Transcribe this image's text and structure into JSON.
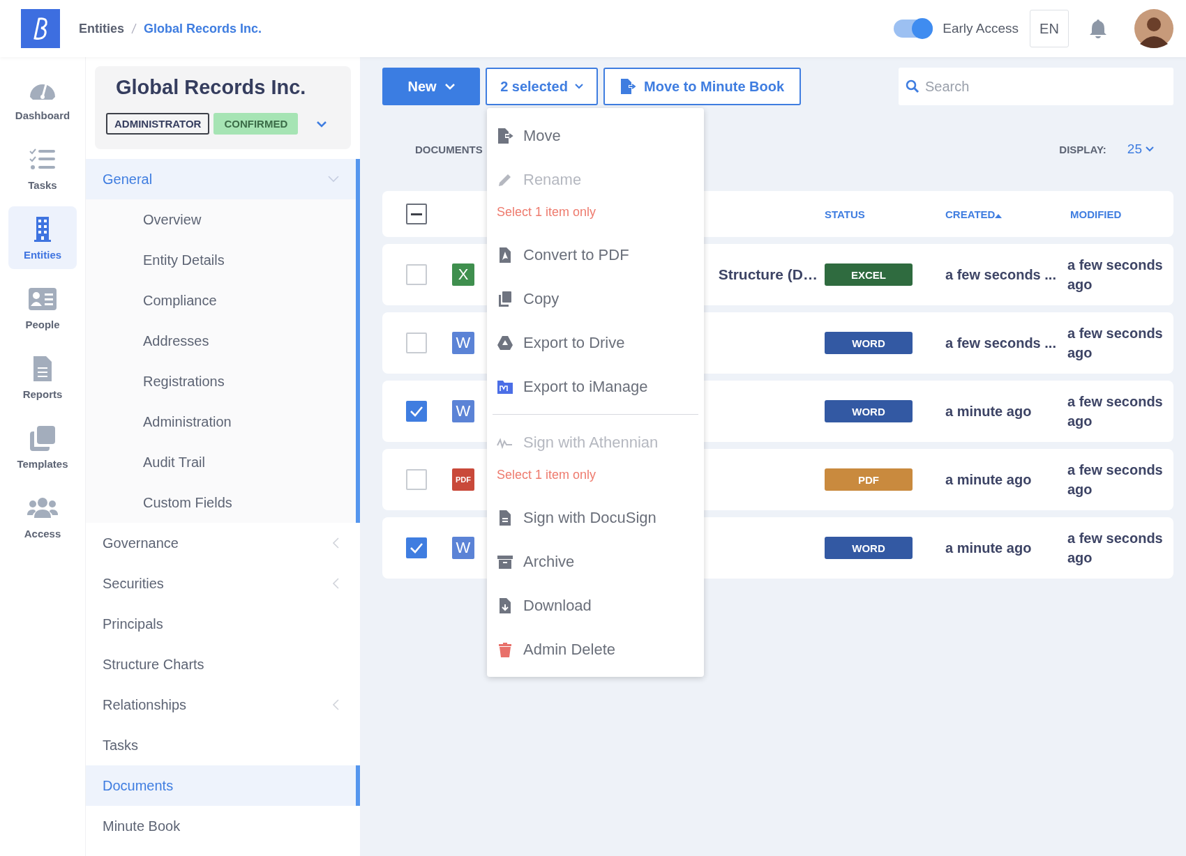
{
  "topbar": {
    "breadcrumbs": [
      {
        "label": "Entities",
        "current": false
      },
      {
        "label": "Global Records Inc.",
        "current": true
      }
    ],
    "early_access": {
      "label": "Early Access",
      "on": true
    },
    "language": "EN"
  },
  "rail": [
    {
      "label": "Dashboard",
      "selected": false
    },
    {
      "label": "Tasks",
      "selected": false
    },
    {
      "label": "Entities",
      "selected": true
    },
    {
      "label": "People",
      "selected": false
    },
    {
      "label": "Reports",
      "selected": false
    },
    {
      "label": "Templates",
      "selected": false
    },
    {
      "label": "Access",
      "selected": false
    }
  ],
  "entity": {
    "name": "Global Records Inc.",
    "role": "ADMINISTRATOR",
    "status": "CONFIRMED"
  },
  "nav": [
    {
      "label": "General",
      "expanded": true,
      "selected": false,
      "children": [
        {
          "label": "Overview"
        },
        {
          "label": "Entity Details"
        },
        {
          "label": "Compliance"
        },
        {
          "label": "Addresses"
        },
        {
          "label": "Registrations"
        },
        {
          "label": "Administration"
        },
        {
          "label": "Audit Trail"
        },
        {
          "label": "Custom Fields"
        }
      ]
    },
    {
      "label": "Governance",
      "expanded": false,
      "selected": false
    },
    {
      "label": "Securities",
      "expanded": false,
      "selected": false
    },
    {
      "label": "Principals",
      "selected": false
    },
    {
      "label": "Structure Charts",
      "selected": false
    },
    {
      "label": "Relationships",
      "expanded": false,
      "selected": false
    },
    {
      "label": "Tasks",
      "selected": false
    },
    {
      "label": "Documents",
      "selected": true
    },
    {
      "label": "Minute Book",
      "selected": false
    }
  ],
  "toolbar": {
    "new_label": "New",
    "selection_label": "2 selected",
    "move_label": "Move to Minute Book",
    "search": {
      "placeholder": "Search"
    }
  },
  "documents_label": "DOCUMENTS",
  "display": {
    "label": "DISPLAY:",
    "value": "25"
  },
  "menu": [
    {
      "kind": "action",
      "label": "Move",
      "disabled": false
    },
    {
      "kind": "action",
      "label": "Rename",
      "disabled": true
    },
    {
      "kind": "hint",
      "label": "Select 1 item only"
    },
    {
      "kind": "action",
      "label": "Convert to PDF",
      "disabled": false
    },
    {
      "kind": "action",
      "label": "Copy",
      "disabled": false
    },
    {
      "kind": "action",
      "label": "Export to Drive",
      "disabled": false
    },
    {
      "kind": "action",
      "label": "Export to iManage",
      "disabled": false
    },
    {
      "kind": "divider"
    },
    {
      "kind": "action",
      "label": "Sign with Athennian",
      "disabled": true
    },
    {
      "kind": "hint",
      "label": "Select 1 item only"
    },
    {
      "kind": "action",
      "label": "Sign with DocuSign",
      "disabled": false
    },
    {
      "kind": "action",
      "label": "Archive",
      "disabled": false
    },
    {
      "kind": "action",
      "label": "Download",
      "disabled": false
    },
    {
      "kind": "action",
      "label": "Admin Delete",
      "disabled": false
    }
  ],
  "table": {
    "select_all_indeterminate": true,
    "columns": [
      {
        "label": "STATUS",
        "sorted": false
      },
      {
        "label": "CREATED",
        "sorted": true
      },
      {
        "label": "MODIFIED",
        "sorted": false
      }
    ],
    "rows": [
      {
        "checked": false,
        "kind": "excel",
        "file_icon": "X",
        "name": "Structure (D…",
        "status": "EXCEL",
        "created": "a few seconds ...",
        "modified": "a few seconds ago"
      },
      {
        "checked": false,
        "kind": "word",
        "file_icon": "W",
        "status": "WORD",
        "created": "a few seconds ...",
        "modified": "a few seconds ago"
      },
      {
        "checked": true,
        "kind": "word",
        "file_icon": "W",
        "status": "WORD",
        "created": "a minute ago",
        "modified": "a few seconds ago"
      },
      {
        "checked": false,
        "kind": "pdf",
        "file_icon": "PDF",
        "status": "PDF",
        "created": "a minute ago",
        "modified": "a few seconds ago"
      },
      {
        "checked": true,
        "kind": "word",
        "file_icon": "W",
        "status": "WORD",
        "created": "a minute ago",
        "modified": "a few seconds ago"
      }
    ]
  }
}
